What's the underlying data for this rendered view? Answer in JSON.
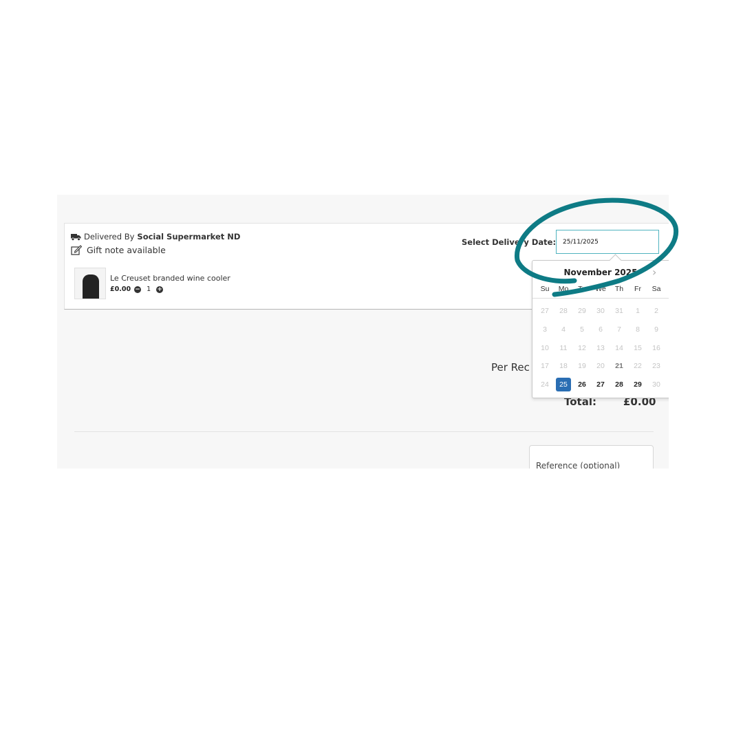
{
  "delivery": {
    "prefix": "Delivered By",
    "vendor": "Social Supermarket ND",
    "gift_note": "Gift note available",
    "date_label": "Select Delivery Date:",
    "date_value": "25/11/2025"
  },
  "product": {
    "name": "Le Creuset branded wine cooler",
    "price": "£0.00",
    "quantity": "1"
  },
  "summary": {
    "per_recipient": "Per Rec",
    "total_label": "Total:",
    "total_value": "£0.00"
  },
  "reference": {
    "placeholder": "Reference (optional)"
  },
  "datepicker": {
    "title": "November 2025",
    "days_of_week": [
      "Su",
      "Mo",
      "Tu",
      "We",
      "Th",
      "Fr",
      "Sa"
    ],
    "weeks": [
      [
        "27",
        "28",
        "29",
        "30",
        "31",
        "1",
        "2"
      ],
      [
        "3",
        "4",
        "5",
        "6",
        "7",
        "8",
        "9"
      ],
      [
        "10",
        "11",
        "12",
        "13",
        "14",
        "15",
        "16"
      ],
      [
        "17",
        "18",
        "19",
        "20",
        "21",
        "22",
        "23"
      ],
      [
        "24",
        "25",
        "26",
        "27",
        "28",
        "29",
        "30"
      ]
    ],
    "selected": "25"
  },
  "colors": {
    "annotation_stroke": "#0e7b85",
    "selected_day": "#2a6eb3",
    "input_border": "#4fb3bf"
  },
  "icons": {
    "delivery": "delivery-truck-icon",
    "gift": "edit-note-icon",
    "minus": "minus-circle-icon",
    "plus": "plus-circle-icon",
    "next": "chevron-right-icon"
  }
}
